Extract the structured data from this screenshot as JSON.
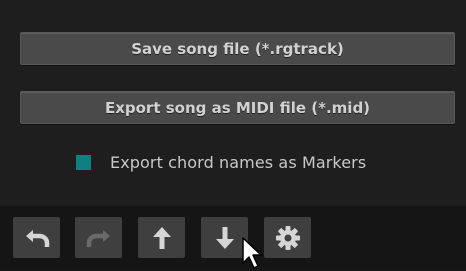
{
  "buttons": {
    "save_label": "Save song file (*.rgtrack)",
    "export_label": "Export song as MIDI file (*.mid)"
  },
  "options": {
    "export_chord_markers_label": "Export chord names as Markers",
    "export_chord_markers_checked": true
  },
  "toolbar": {
    "items": [
      {
        "icon": "undo-icon",
        "enabled": true
      },
      {
        "icon": "redo-icon",
        "enabled": false
      },
      {
        "icon": "arrow-up-icon",
        "enabled": true
      },
      {
        "icon": "arrow-down-icon",
        "enabled": true
      },
      {
        "icon": "gear-icon",
        "enabled": true
      }
    ]
  },
  "colors": {
    "checkbox_accent": "#0e8080",
    "button_bg": "#4a4a4a",
    "panel_bg": "#1e1e1e"
  }
}
